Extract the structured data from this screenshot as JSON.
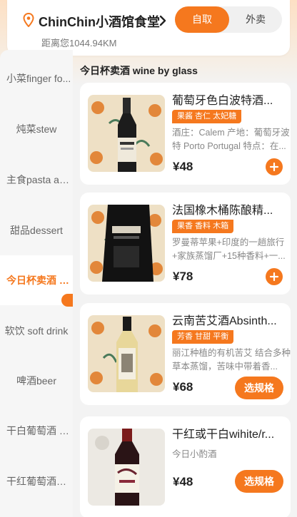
{
  "colors": {
    "accent": "#f5781e",
    "text": "#222222",
    "muted": "#888888"
  },
  "store": {
    "name": "ChinChin小酒馆食堂",
    "distance": "距离您1044.94KM",
    "modes": [
      "自取",
      "外卖"
    ],
    "active_mode": "自取"
  },
  "sidebar": {
    "active": "今日杯卖酒 wine by glass",
    "items": [
      {
        "label": "小菜finger fo..."
      },
      {
        "label": "炖菜stew"
      },
      {
        "label": "主食pasta an..."
      },
      {
        "label": "甜品dessert"
      },
      {
        "label": "今日杯卖酒 w..."
      },
      {
        "label": "软饮 soft drink"
      },
      {
        "label": "啤酒beer"
      },
      {
        "label": "干白葡萄酒 D..."
      },
      {
        "label": "干红葡萄酒Dr..."
      }
    ]
  },
  "section": {
    "title": "今日杯卖酒 wine by glass"
  },
  "products": [
    {
      "name": "葡萄牙色白波特酒...",
      "tags": "果酱 杏仁 太妃糖",
      "desc": "酒庄：Calem 产地：葡萄牙波特 Porto Portugal 特点：在...",
      "price": "¥48",
      "action": "add",
      "thumb_icon": "wine-bottle-icon"
    },
    {
      "name": "法国橡木桶陈酿精...",
      "tags": "果香 香料 木箱",
      "desc": "罗曼蒂苹果+印度的一趟旅行+家族蒸馏厂+15种香料+一...",
      "price": "¥78",
      "action": "add",
      "thumb_icon": "wine-bottle-icon"
    },
    {
      "name": "云南苦艾酒Absinth...",
      "tags": "芳香 甘甜 平衡",
      "desc": "丽江种植的有机苦艾 结合多种草本蒸馏，苦味中带着香...",
      "price": "¥68",
      "action": "spec",
      "action_label": "选规格",
      "thumb_icon": "wine-bottle-icon"
    },
    {
      "name": "干红或干白wihite/r...",
      "tags": "",
      "desc": "今日小酌酒",
      "price": "¥48",
      "action": "spec",
      "action_label": "选规格",
      "thumb_icon": "wine-bottle-icon"
    }
  ]
}
